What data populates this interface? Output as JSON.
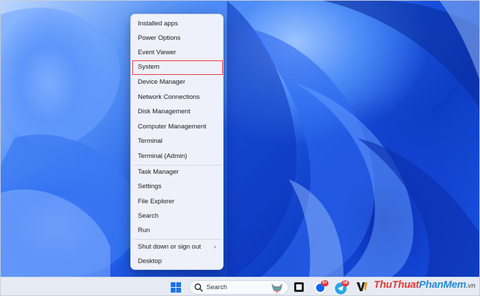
{
  "context_menu": {
    "items": [
      {
        "label": "Installed apps"
      },
      {
        "label": "Power Options"
      },
      {
        "label": "Event Viewer"
      },
      {
        "label": "System"
      },
      {
        "label": "Device Manager"
      },
      {
        "label": "Network Connections"
      },
      {
        "label": "Disk Management"
      },
      {
        "label": "Computer Management"
      },
      {
        "label": "Terminal"
      },
      {
        "label": "Terminal (Admin)"
      },
      {
        "label": "Task Manager"
      },
      {
        "label": "Settings"
      },
      {
        "label": "File Explorer"
      },
      {
        "label": "Search"
      },
      {
        "label": "Run"
      },
      {
        "label": "Shut down or sign out",
        "submenu_icon": "chevron-right-icon"
      },
      {
        "label": "Desktop"
      }
    ],
    "highlighted_item": "System",
    "highlight_color": "#e0393e"
  },
  "taskbar": {
    "search_placeholder": "Search",
    "icons": [
      "windows-start-icon",
      "search-icon",
      "bing-mascot-icon",
      "app-icon",
      "zalo-icon",
      "telegram-icon",
      "w-app-icon"
    ],
    "zalo_badge": "5+",
    "telegram_badge": "18"
  },
  "watermark": {
    "part1": "ThuThuat",
    "part2": "PhanMem",
    "part3": ".vn"
  },
  "colors": {
    "desktop_accent": "#1a4fd6",
    "menu_bg": "#eef1f9",
    "taskbar_bg": "#e6ebf3"
  }
}
